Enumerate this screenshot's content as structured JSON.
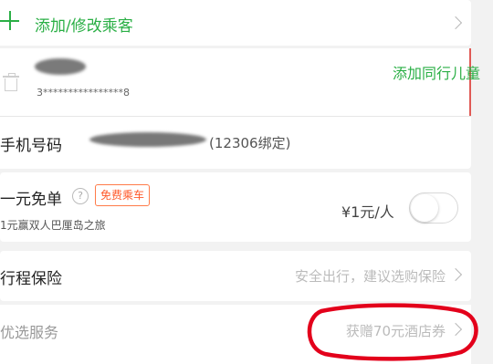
{
  "add_passenger": {
    "label": "添加/修改乘客",
    "icon": "plus-icon",
    "accent": "#2aaf45"
  },
  "passenger": {
    "id_masked": "3****************8",
    "add_child_label": "添加同行儿童"
  },
  "phone": {
    "label": "手机号码",
    "suffix": "(12306绑定)"
  },
  "one_yuan_free": {
    "title": "一元免单",
    "help_icon_glyph": "?",
    "badge": "免费乘车",
    "subtitle": "1元赢双人巴厘岛之旅",
    "price": "¥1元/人",
    "toggle_on": false
  },
  "insurance": {
    "label": "行程保险",
    "hint": "安全出行，建议选购保险"
  },
  "services": {
    "label": "优选服务",
    "hint": "获赠70元酒店券"
  }
}
